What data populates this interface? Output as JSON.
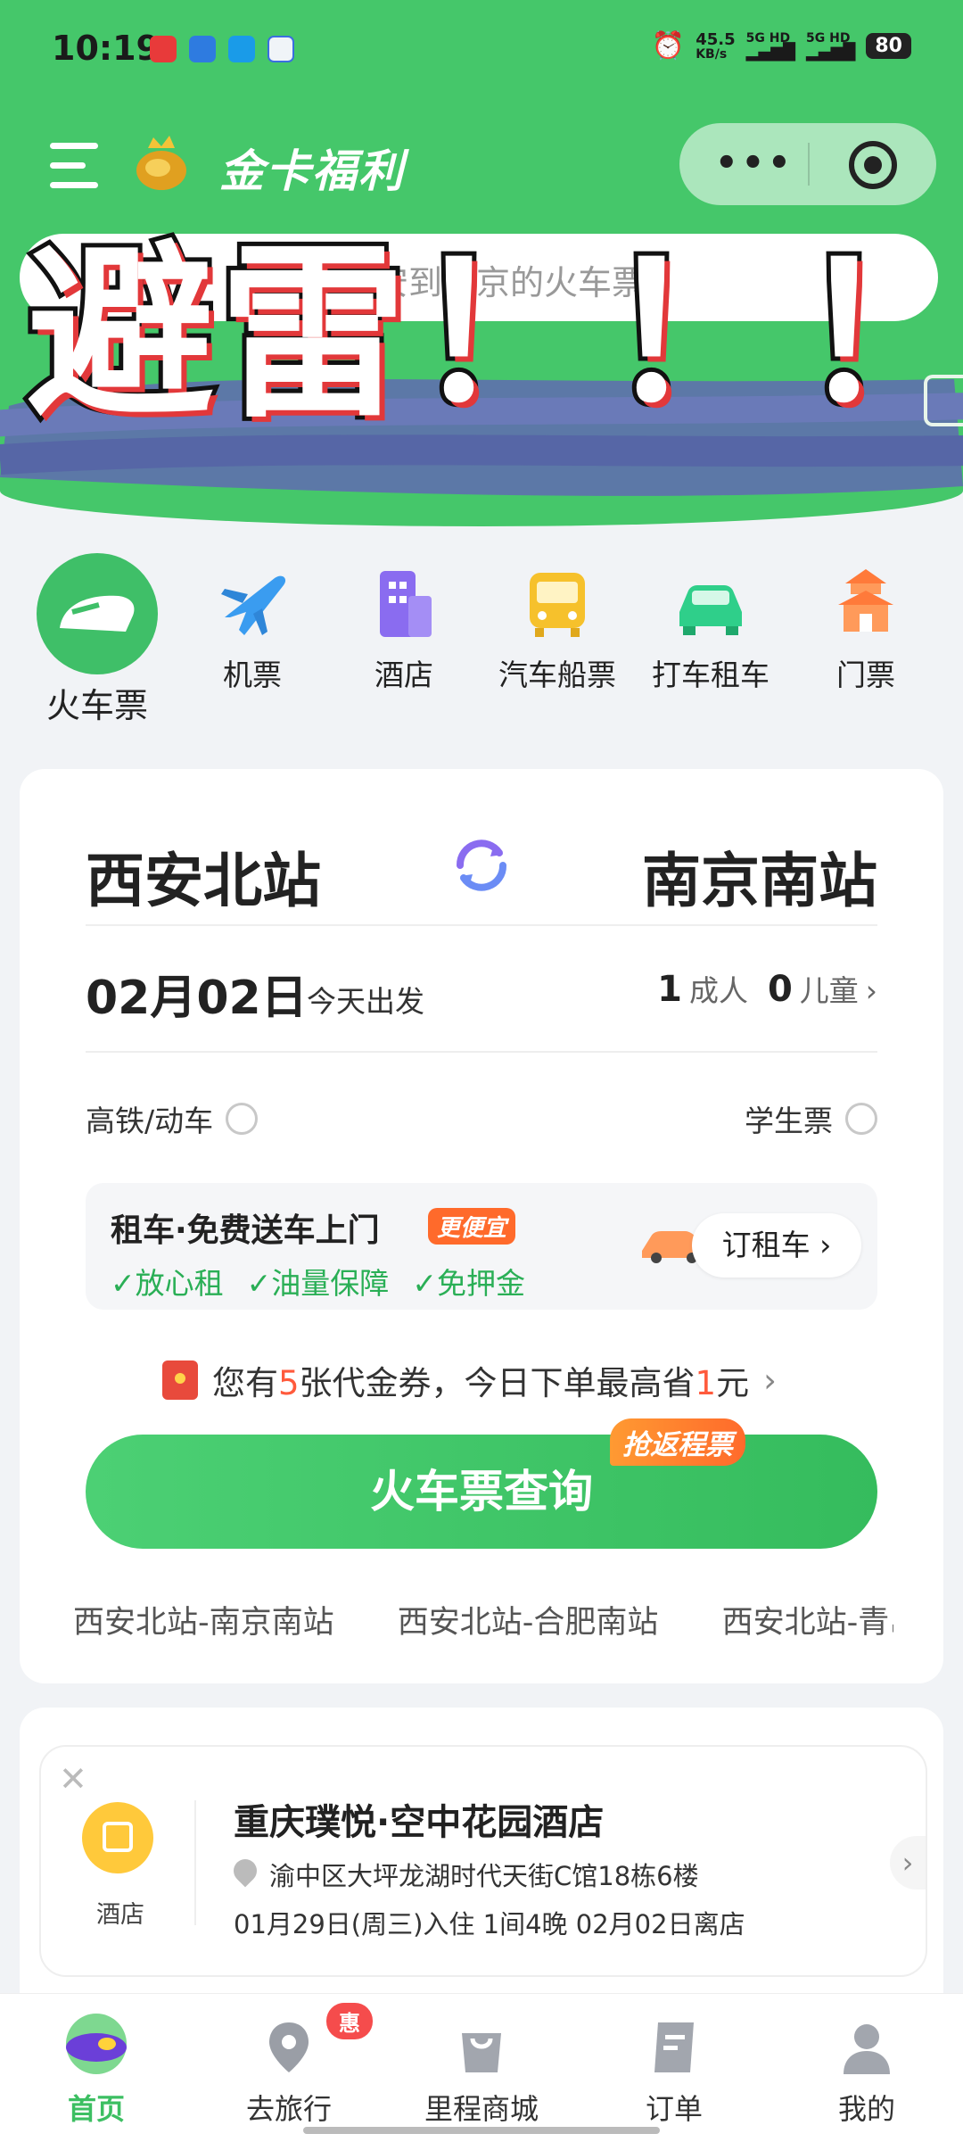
{
  "status_bar": {
    "time": "10:19",
    "net_speed": "45.5",
    "net_unit": "KB/s",
    "signal1": "5G HD",
    "signal2": "5G HD",
    "battery": "80"
  },
  "header": {
    "brand": "金卡福利",
    "search_placeholder": "西安到南京的火车票"
  },
  "overlay_text": "避雷！！！",
  "categories": [
    {
      "label": "火车票",
      "icon": "train-icon"
    },
    {
      "label": "机票",
      "icon": "plane-icon"
    },
    {
      "label": "酒店",
      "icon": "hotel-building-icon"
    },
    {
      "label": "汽车船票",
      "icon": "bus-icon"
    },
    {
      "label": "打车租车",
      "icon": "car-icon"
    },
    {
      "label": "门票",
      "icon": "temple-icon"
    }
  ],
  "booking": {
    "from": "西安北站",
    "to": "南京南站",
    "date": "02月02日",
    "date_note": "今天出发",
    "adults": "1",
    "adults_label": "成人",
    "children": "0",
    "children_label": "儿童",
    "option_highspeed": "高铁/动车",
    "option_student": "学生票",
    "rental_title": "租车·免费送车上门",
    "rental_tag": "更便宜",
    "rental_features": [
      "✓放心租",
      "✓油量保障",
      "✓免押金"
    ],
    "rental_button": "订租车",
    "coupon_prefix": "您有",
    "coupon_count": "5",
    "coupon_mid": "张代金券，今日下单最高省",
    "coupon_amount": "1",
    "coupon_suffix": "元",
    "query_button": "火车票查询",
    "promo_tag": "抢返程票",
    "history": [
      "西安北站-南京南站",
      "西安北站-合肥南站",
      "西安北站-青岛"
    ]
  },
  "hotel": {
    "label": "酒店",
    "name": "重庆璞悦·空中花园酒店",
    "address": "渝中区大坪龙湖时代天街C馆18栋6楼",
    "stay": "01月29日(周三)入住  1间4晚  02月02日离店"
  },
  "tabbar": [
    {
      "label": "首页",
      "icon": "home-blimp-icon",
      "active": true
    },
    {
      "label": "去旅行",
      "icon": "location-pin-icon",
      "badge": "惠"
    },
    {
      "label": "里程商城",
      "icon": "shopping-bag-icon"
    },
    {
      "label": "订单",
      "icon": "order-doc-icon"
    },
    {
      "label": "我的",
      "icon": "profile-icon"
    }
  ],
  "colors": {
    "brand_green": "#45c76a",
    "accent_orange": "#ff6a2b",
    "coupon_red": "#ff5a3c",
    "swap_purple": "#7b5cf0"
  }
}
